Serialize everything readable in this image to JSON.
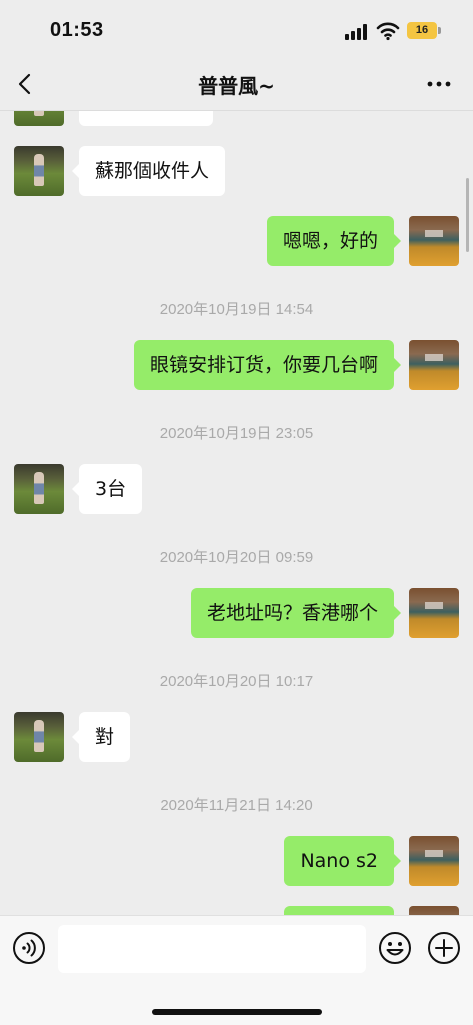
{
  "status_bar": {
    "time": "01:53",
    "battery_level": "16",
    "signal_icon": "cellular-signal-icon",
    "wifi_icon": "wifi-icon",
    "battery_color": "#f4c542"
  },
  "header": {
    "title": "普普風~",
    "back_icon": "chevron-left-icon",
    "more_icon": "ellipsis-icon"
  },
  "chat": {
    "colors": {
      "incoming_bubble": "#ffffff",
      "outgoing_bubble": "#95ec69",
      "background": "#ededed"
    },
    "items": [
      {
        "type": "message",
        "direction": "incoming",
        "text": "蘇那個收件人"
      },
      {
        "type": "message",
        "direction": "outgoing",
        "text": "嗯嗯，好的"
      },
      {
        "type": "timestamp",
        "text": "2020年10月19日 14:54"
      },
      {
        "type": "message",
        "direction": "outgoing",
        "text": "眼镜安排订货，你要几台啊"
      },
      {
        "type": "timestamp",
        "text": "2020年10月19日 23:05"
      },
      {
        "type": "message",
        "direction": "incoming",
        "text": "3台"
      },
      {
        "type": "timestamp",
        "text": "2020年10月20日 09:59"
      },
      {
        "type": "message",
        "direction": "outgoing",
        "text": "老地址吗？香港哪个"
      },
      {
        "type": "timestamp",
        "text": "2020年10月20日 10:17"
      },
      {
        "type": "message",
        "direction": "incoming",
        "text": "對"
      },
      {
        "type": "timestamp",
        "text": "2020年11月21日 14:20"
      },
      {
        "type": "message",
        "direction": "outgoing",
        "text": "Nano s2"
      }
    ]
  },
  "input_bar": {
    "voice_icon": "voice-input-icon",
    "message_value": "",
    "emoji_icon": "emoji-icon",
    "plus_icon": "plus-circle-icon"
  }
}
